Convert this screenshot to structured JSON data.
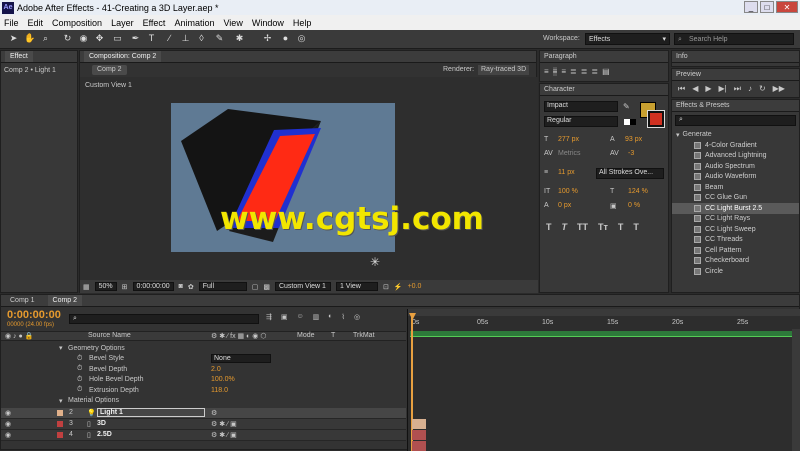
{
  "window": {
    "app_logo": "Ae",
    "title": "Adobe After Effects - 41-Creating a 3D Layer.aep *",
    "min": "_",
    "max": "□",
    "close": "✕"
  },
  "menu": [
    "File",
    "Edit",
    "Composition",
    "Layer",
    "Effect",
    "Animation",
    "View",
    "Window",
    "Help"
  ],
  "toolbar": {
    "workspace_label": "Workspace:",
    "workspace_value": "Effects",
    "search_placeholder": "Search Help"
  },
  "left_panel": {
    "tab": "Effect",
    "subtitle": "Comp 2 • Light 1"
  },
  "comp_panel": {
    "tab": "Composition: Comp 2",
    "crumb": "Comp 2",
    "renderer_label": "Renderer:",
    "renderer_value": "Ray-traced 3D",
    "view_label": "Custom View 1",
    "zoom": "50%",
    "time": "0:00:00:00",
    "resolution": "Full",
    "view_select": "Custom View 1",
    "views": "1 View",
    "exposure": "+0.0"
  },
  "watermark": "www.cgtsj.com",
  "paragraph_panel": {
    "title": "Paragraph"
  },
  "character_panel": {
    "title": "Character",
    "font": "Impact",
    "style": "Regular",
    "size": "277 px",
    "leading": "93 px",
    "kerning": "Metrics",
    "tracking": "-3",
    "stroke_size": "11 px",
    "stroke_mode": "All Strokes Ove...",
    "vscale": "100 %",
    "hscale": "124 %",
    "baseline": "0 px",
    "tsume": "0 %",
    "t_buttons": [
      "T",
      "T",
      "TT",
      "Tт",
      "T",
      "T"
    ]
  },
  "info_panel": {
    "title": "Info"
  },
  "preview_panel": {
    "title": "Preview"
  },
  "effects_panel": {
    "title": "Effects & Presets",
    "category": "Generate",
    "items": [
      "4-Color Gradient",
      "Advanced Lightning",
      "Audio Spectrum",
      "Audio Waveform",
      "Beam",
      "CC Glue Gun",
      "CC Light Burst 2.5",
      "CC Light Rays",
      "CC Light Sweep",
      "CC Threads",
      "Cell Pattern",
      "Checkerboard",
      "Circle"
    ],
    "selected_index": 6
  },
  "timeline": {
    "tabs": [
      "Comp 1",
      "Comp 2"
    ],
    "timecode": "0:00:00:00",
    "fps": "00000 (24.00 fps)",
    "columns": {
      "source": "Source Name",
      "mode": "Mode",
      "t": "T",
      "trkmat": "TrkMat"
    },
    "ruler": [
      "0s",
      "05s",
      "10s",
      "15s",
      "20s",
      "25s"
    ],
    "props": [
      {
        "label": "Geometry Options",
        "value": "",
        "indent": 1
      },
      {
        "label": "Bevel Style",
        "value": "None",
        "indent": 2
      },
      {
        "label": "Bevel Depth",
        "value": "2.0",
        "indent": 2
      },
      {
        "label": "Hole Bevel Depth",
        "value": "100.0%",
        "indent": 2
      },
      {
        "label": "Extrusion Depth",
        "value": "118.0",
        "indent": 2
      },
      {
        "label": "Material Options",
        "value": "",
        "indent": 1
      }
    ],
    "layers": [
      {
        "num": "2",
        "name": "Light 1",
        "color": "#e0b08a"
      },
      {
        "num": "3",
        "name": "3D",
        "color": "#c04040"
      },
      {
        "num": "4",
        "name": "2.5D",
        "color": "#c04040"
      }
    ]
  },
  "colors": {
    "viewport_bg": "#5f7a94",
    "extrude_face": "#ff2a14",
    "extrude_border": "#2030d0",
    "accent": "#e69a2e",
    "fill_swatch": "#c8a030",
    "stroke_swatch": "#d03020"
  }
}
